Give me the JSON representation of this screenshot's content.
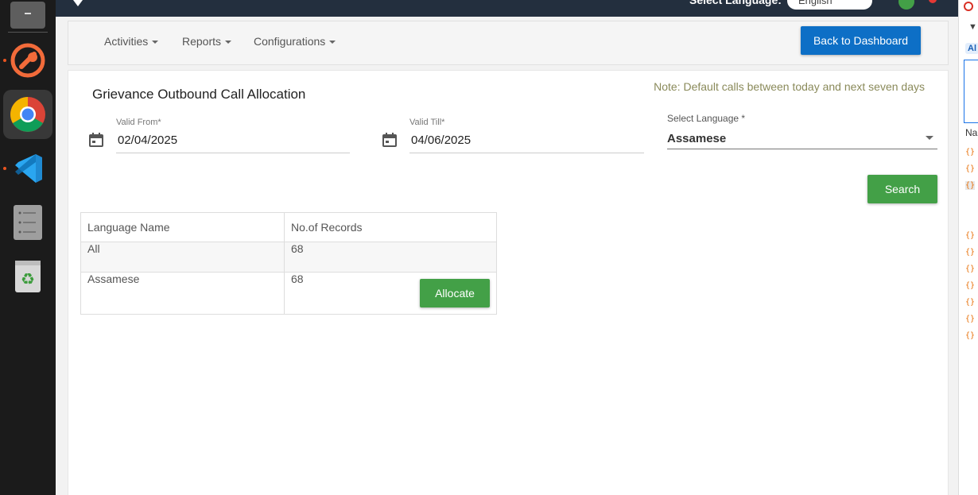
{
  "topbar": {
    "select_language_label": "Select Language:",
    "language_value": "English"
  },
  "nav": {
    "activities": "Activities",
    "reports": "Reports",
    "configurations": "Configurations",
    "back_to_dashboard": "Back to Dashboard"
  },
  "page": {
    "title": "Grievance Outbound Call Allocation",
    "note": "Note: Default calls between today and next seven days"
  },
  "form": {
    "valid_from_label": "Valid From*",
    "valid_from_value": "02/04/2025",
    "valid_till_label": "Valid Till*",
    "valid_till_value": "04/06/2025",
    "language_label": "Select Language *",
    "language_value": "Assamese",
    "search_label": "Search"
  },
  "table": {
    "headers": [
      "Language Name",
      "No.of Records"
    ],
    "rows": [
      {
        "language": "All",
        "records": "68"
      },
      {
        "language": "Assamese",
        "records": "68",
        "action": "Allocate"
      }
    ]
  },
  "devtools": {
    "tab_label": "Al",
    "column_label": "Na",
    "item_glyph": "{}"
  },
  "colors": {
    "primary_button": "#0d6fc6",
    "success_button": "#43a047",
    "topbar": "#232f3e"
  }
}
